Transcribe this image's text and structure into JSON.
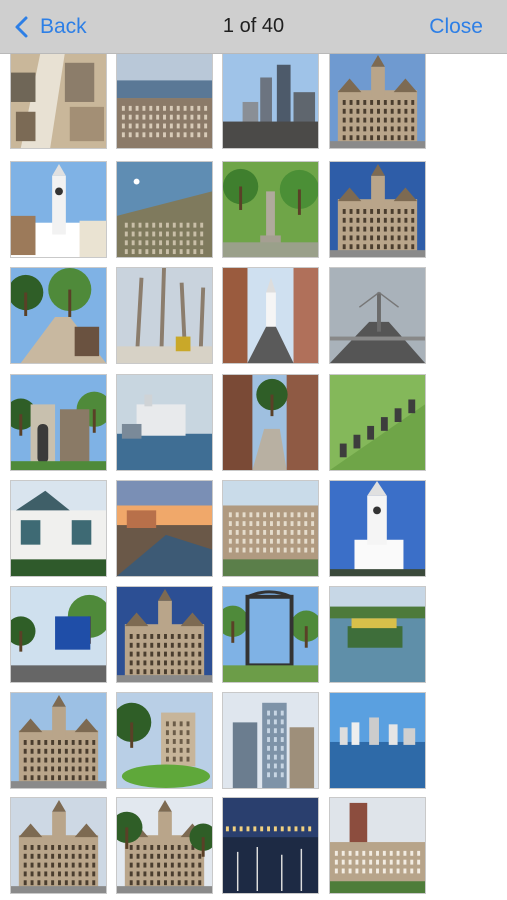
{
  "nav": {
    "back_label": "Back",
    "title": "1 of 40",
    "close_label": "Close"
  },
  "colors": {
    "accent": "#2d7fe6",
    "navbar": "#cfcfcf"
  },
  "thumbnails": [
    {
      "scene": "aerial-street"
    },
    {
      "scene": "aerial-city"
    },
    {
      "scene": "towers"
    },
    {
      "scene": "city-hall"
    },
    {
      "scene": "clock-tower"
    },
    {
      "scene": "aerial-harbour"
    },
    {
      "scene": "park-monument"
    },
    {
      "scene": "city-hall-front"
    },
    {
      "scene": "park-path"
    },
    {
      "scene": "winter-trees"
    },
    {
      "scene": "street-steeple"
    },
    {
      "scene": "bridge-road"
    },
    {
      "scene": "stone-gate"
    },
    {
      "scene": "ship-harbour"
    },
    {
      "scene": "narrow-street"
    },
    {
      "scene": "cannon-row"
    },
    {
      "scene": "house"
    },
    {
      "scene": "waterfront-sunset"
    },
    {
      "scene": "aerial-town"
    },
    {
      "scene": "clock-tower-blue"
    },
    {
      "scene": "welcome-sign"
    },
    {
      "scene": "city-hall-dusk"
    },
    {
      "scene": "garden-gate"
    },
    {
      "scene": "tour-boat"
    },
    {
      "scene": "city-hall-side"
    },
    {
      "scene": "plaza-green"
    },
    {
      "scene": "glass-towers"
    },
    {
      "scene": "skyline-water"
    },
    {
      "scene": "city-hall-corner"
    },
    {
      "scene": "city-hall-trees"
    },
    {
      "scene": "marina-night"
    },
    {
      "scene": "downtown-aerial"
    }
  ]
}
